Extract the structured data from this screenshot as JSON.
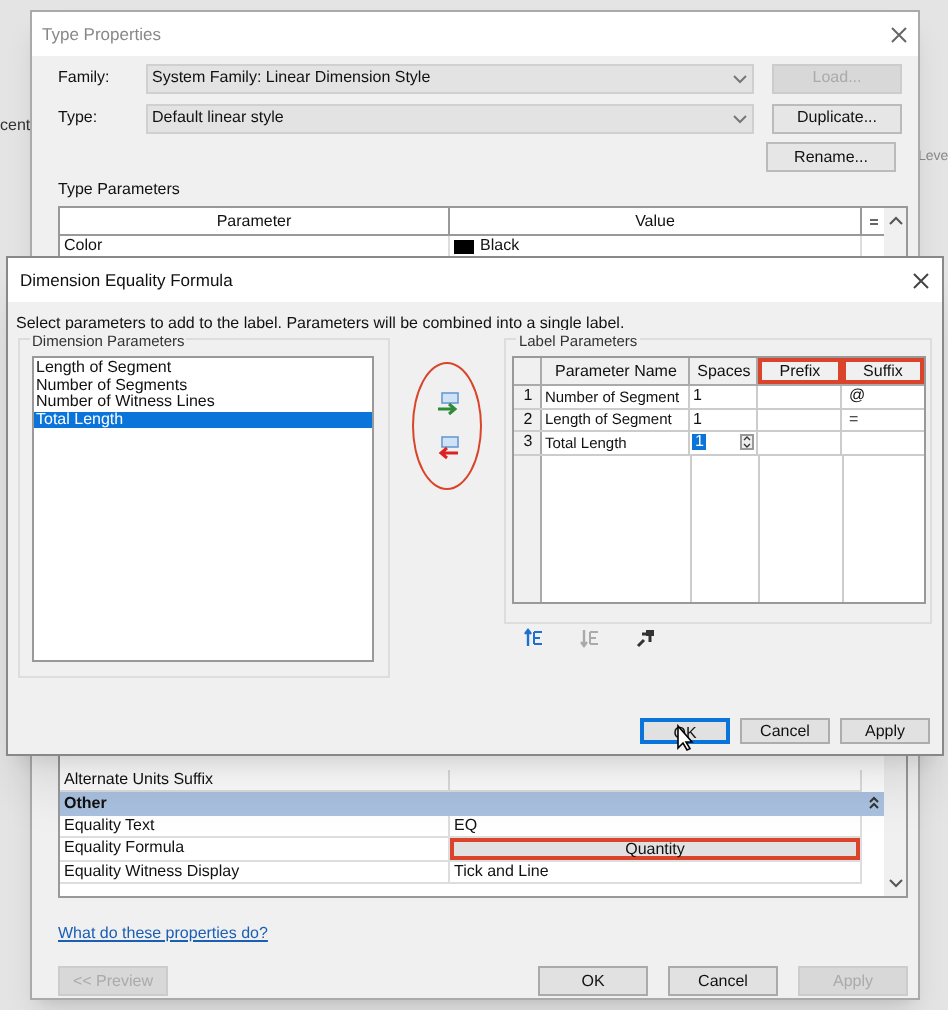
{
  "background_texts": [
    "cent",
    "Leve"
  ],
  "type_properties": {
    "title": "Type Properties",
    "family": {
      "label": "Family:",
      "value": "System Family: Linear Dimension Style"
    },
    "type": {
      "label": "Type:",
      "value": "Default linear style"
    },
    "side_buttons": [
      {
        "label": "Load...",
        "disabled": true
      },
      {
        "label": "Duplicate...",
        "disabled": false
      },
      {
        "label": "Rename...",
        "disabled": false
      }
    ],
    "section_label": "Type Parameters",
    "columns": [
      "Parameter",
      "Value"
    ],
    "top_rows": [
      {
        "parameter": "Color",
        "value": "Black",
        "kind": "color",
        "color": "#000000"
      }
    ],
    "bottom_rows": [
      {
        "parameter": "Alternate Units Suffix",
        "kind": "text"
      },
      {
        "kind": "group",
        "parameter": "Other"
      },
      {
        "parameter": "Equality Text",
        "value": "EQ",
        "kind": "text"
      },
      {
        "parameter": "Equality Formula",
        "value": "Quantity",
        "kind": "button",
        "highlighted": true
      },
      {
        "parameter": "Equality Witness Display",
        "value": "Tick and Line",
        "kind": "text"
      }
    ],
    "help_link": "What do these properties do?",
    "buttons": [
      {
        "label": "<< Preview",
        "disabled": true
      },
      {
        "label": "OK",
        "disabled": false
      },
      {
        "label": "Cancel",
        "disabled": false
      },
      {
        "label": "Apply",
        "disabled": true
      }
    ]
  },
  "formula_dialog": {
    "title": "Dimension Equality Formula",
    "instruction": "Select parameters to add to the label. Parameters will be combined into a single label.",
    "dimension_parameters": {
      "label": "Dimension Parameters",
      "items": [
        {
          "label": "Length of Segment",
          "selected": false
        },
        {
          "label": "Number of Segments",
          "selected": false
        },
        {
          "label": "Number of Witness Lines",
          "selected": false
        },
        {
          "label": "Total Length",
          "selected": true
        }
      ]
    },
    "arrows_highlighted": true,
    "label_parameters": {
      "label": "Label Parameters",
      "columns": [
        {
          "label": "Parameter Name",
          "highlighted": false
        },
        {
          "label": "Spaces",
          "highlighted": false
        },
        {
          "label": "Prefix",
          "highlighted": true
        },
        {
          "label": "Suffix",
          "highlighted": true
        }
      ],
      "rows": [
        {
          "index": "1",
          "name": "Number of Segment",
          "spaces": "1",
          "suffix": "@",
          "editing": false
        },
        {
          "index": "2",
          "name": "Length of Segment",
          "spaces": "1",
          "suffix": "=",
          "editing": false
        },
        {
          "index": "3",
          "name": "Total Length",
          "spaces": "1",
          "editing": true
        }
      ]
    },
    "buttons": [
      {
        "label": "OK",
        "focused": true
      },
      {
        "label": "Cancel",
        "focused": false
      },
      {
        "label": "Apply",
        "focused": false
      }
    ]
  }
}
